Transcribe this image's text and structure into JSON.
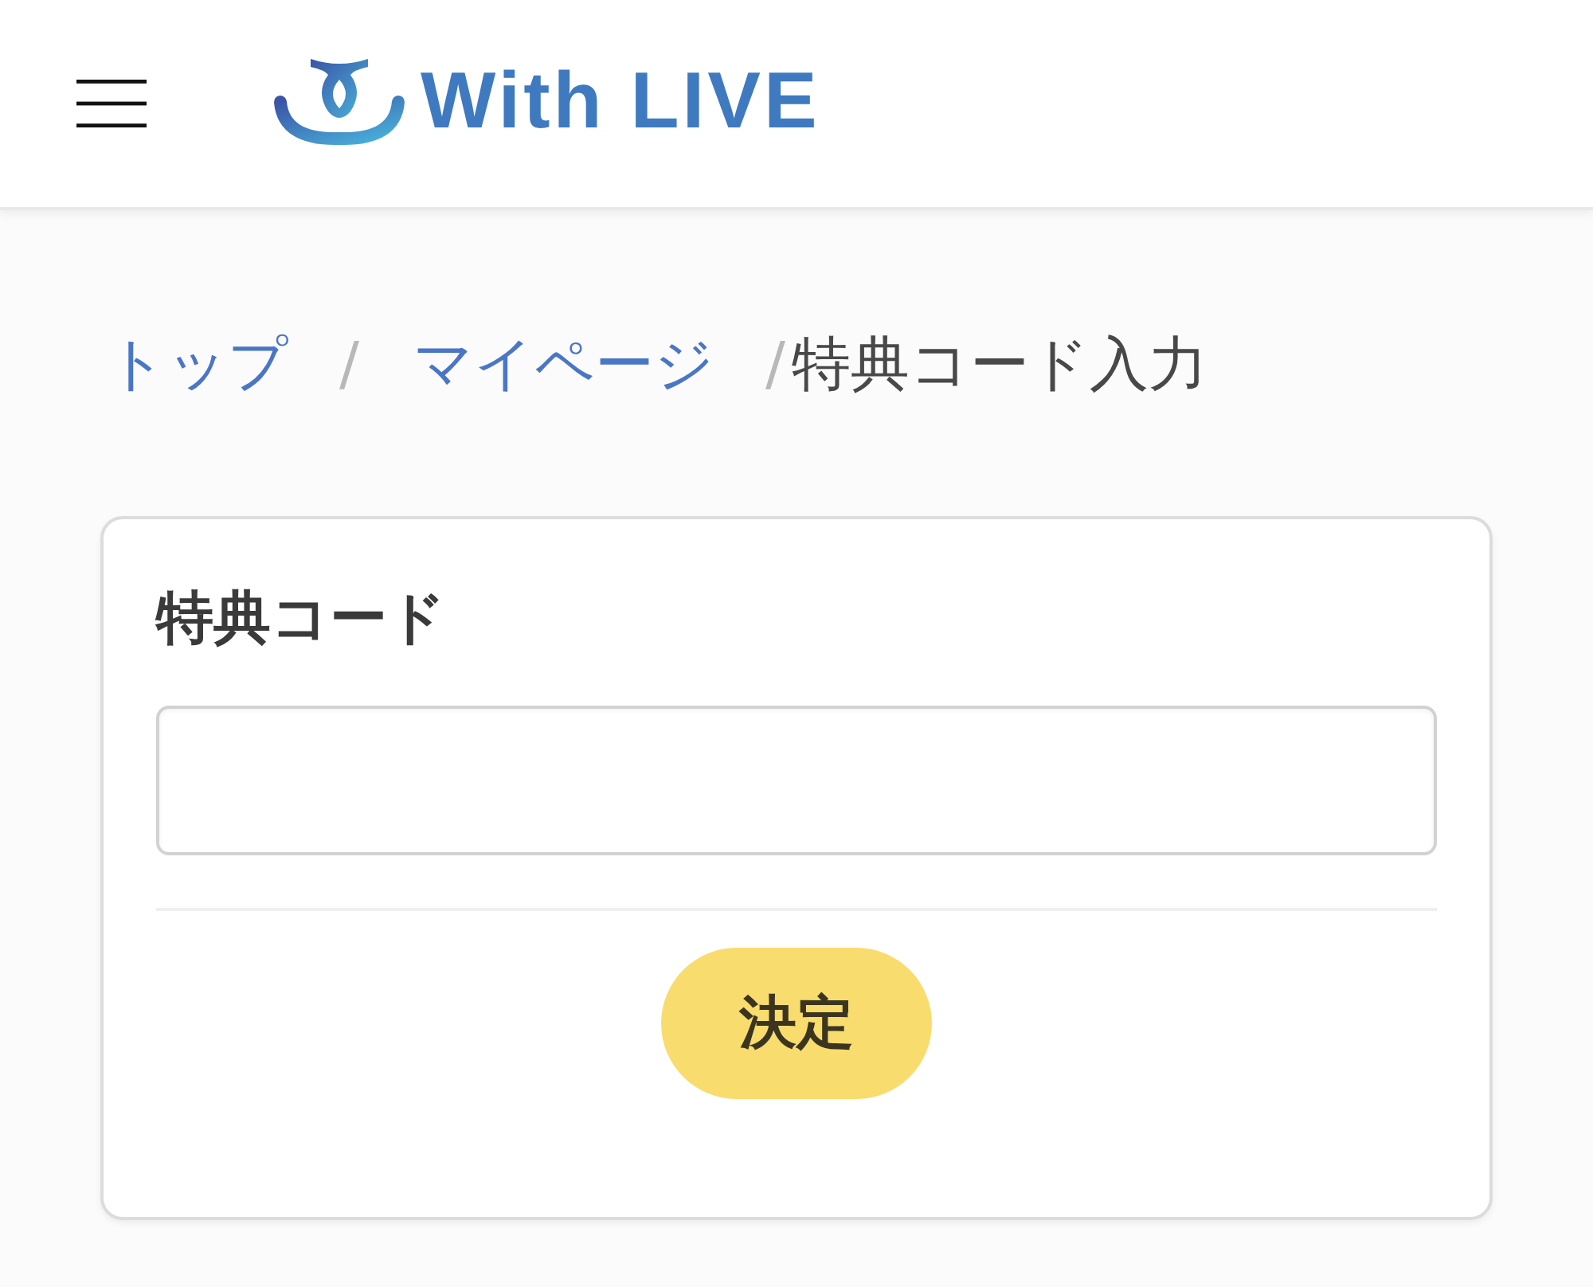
{
  "header": {
    "logo_text": "With LIVE"
  },
  "breadcrumb": [
    {
      "kind": "link",
      "label": "トップ"
    },
    {
      "kind": "separator",
      "label": "/"
    },
    {
      "kind": "link",
      "label": "マイページ"
    },
    {
      "kind": "separator",
      "label": "/"
    },
    {
      "kind": "current",
      "label": "特典コード入力"
    }
  ],
  "card": {
    "title": "特典コード",
    "button": "決定"
  }
}
